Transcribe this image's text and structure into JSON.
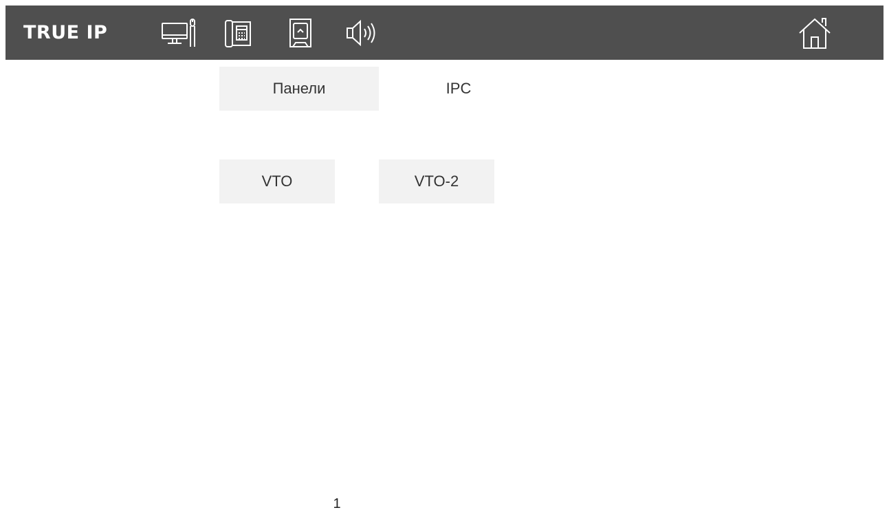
{
  "header": {
    "brand": "TRUE IP",
    "icons": [
      "monitor-icon",
      "calculator-phone-icon",
      "sd-card-icon",
      "speaker-icon",
      "home-icon"
    ]
  },
  "tabs": [
    {
      "label": "Панели",
      "active": true
    },
    {
      "label": "IPC",
      "active": false
    }
  ],
  "devices": [
    {
      "label": "VTO"
    },
    {
      "label": "VTO-2"
    }
  ],
  "pagination": {
    "current": "1"
  },
  "colors": {
    "topbar": "#4f4f4f",
    "tab_active_bg": "#f2f2f2",
    "icon_stroke": "#ffffff"
  }
}
